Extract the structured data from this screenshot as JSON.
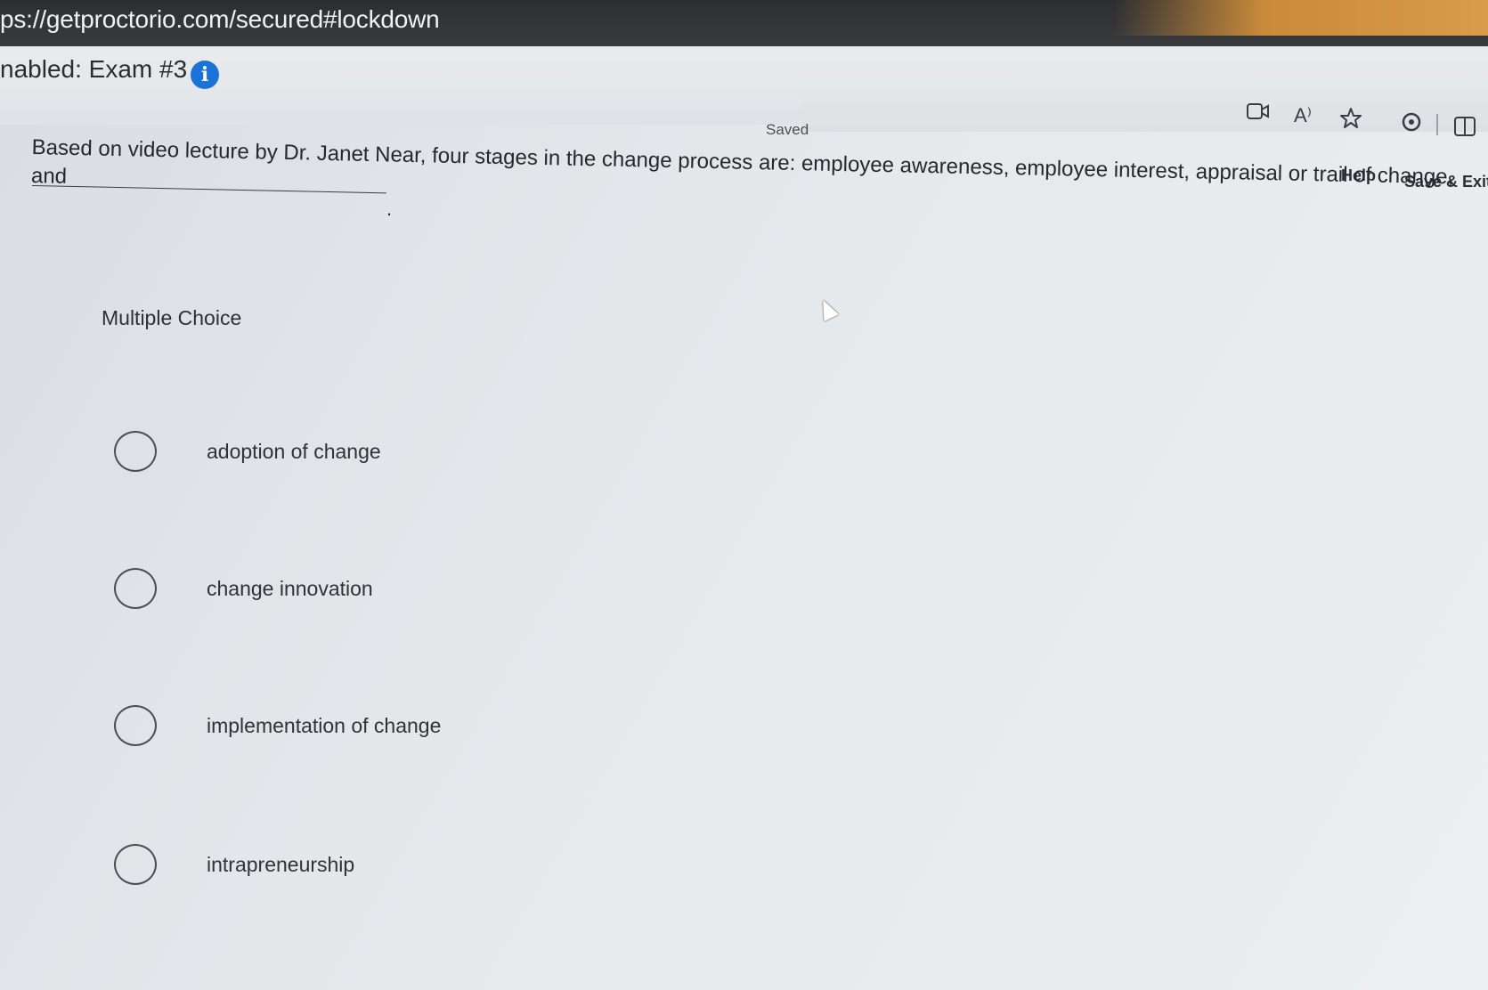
{
  "browser": {
    "url": "ps://getproctorio.com/secured#lockdown"
  },
  "header": {
    "title": "nabled: Exam #3",
    "info_icon": "info-icon"
  },
  "toolbar": {
    "saved": "Saved",
    "icons": [
      "video-icon",
      "read-aloud-icon",
      "favorite-star-icon",
      "extensions-icon",
      "split-screen-icon"
    ],
    "read_aloud_glyph": "A⁾",
    "help": "Help",
    "save_exit": "Save & Exit"
  },
  "question": {
    "text": "Based on video lecture by Dr. Janet Near, four stages in the change process are: employee awareness, employee interest, appraisal or trail of change, and",
    "trailing": ".",
    "type_label": "Multiple Choice",
    "options": [
      {
        "label": "adoption of change",
        "selected": false
      },
      {
        "label": "change innovation",
        "selected": false
      },
      {
        "label": "implementation of change",
        "selected": false
      },
      {
        "label": "intrapreneurship",
        "selected": false
      }
    ]
  },
  "colors": {
    "chrome": "#2d2e31",
    "accent": "#1a73d9",
    "background": "#dfe3e8"
  }
}
